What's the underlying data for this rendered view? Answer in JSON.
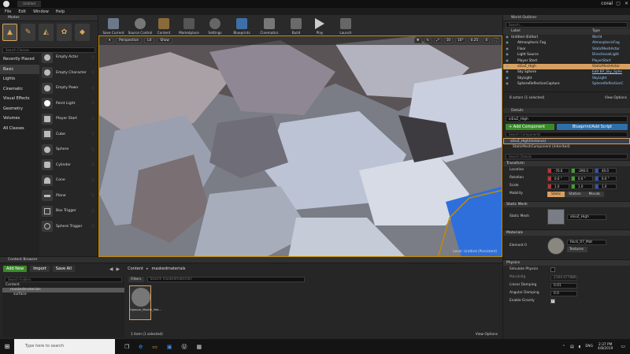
{
  "titlebar": {
    "tab": "Untitled",
    "user": "coral",
    "win_min": "—",
    "win_max": "▢",
    "win_close": "✕"
  },
  "menu": [
    "File",
    "Edit",
    "Window",
    "Help"
  ],
  "modes": {
    "title": "Modes",
    "search_placeholder": "Search Classes",
    "categories": [
      "Recently Placed",
      "Basic",
      "Lights",
      "Cinematic",
      "Visual Effects",
      "Geometry",
      "Volumes",
      "All Classes"
    ],
    "items": [
      "Empty Actor",
      "Empty Character",
      "Empty Pawn",
      "Point Light",
      "Player Start",
      "Cube",
      "Sphere",
      "Cylinder",
      "Cone",
      "Plane",
      "Box Trigger",
      "Sphere Trigger"
    ]
  },
  "toolbar": [
    "Save Current",
    "Source Control",
    "Content",
    "Marketplace",
    "Settings",
    "Blueprints",
    "Cinematics",
    "Build",
    "Play",
    "Launch"
  ],
  "viewport": {
    "mode": "Perspective",
    "lit": "Lit",
    "show": "Show",
    "fov": "10°",
    "grid": "10",
    "angle": "0.25",
    "cam": "4",
    "level_label": "Level:",
    "level_name": "Untitled (Persistent)"
  },
  "outliner": {
    "title": "World Outliner",
    "search_placeholder": "Search...",
    "col_label": "Label",
    "col_type": "Type",
    "rows": [
      {
        "name": "Untitled (Editor)",
        "type": "World"
      },
      {
        "name": "Atmospheric Fog",
        "type": "AtmosphericFog"
      },
      {
        "name": "Floor",
        "type": "StaticMeshActor"
      },
      {
        "name": "Light Source",
        "type": "DirectionalLight"
      },
      {
        "name": "Player Start",
        "type": "PlayerStart"
      },
      {
        "name": "siEoZ_High",
        "type": "StaticMeshActor"
      },
      {
        "name": "Sky Sphere",
        "type": "Edit BP_Sky_Sphe"
      },
      {
        "name": "SkyLight",
        "type": "SkyLight"
      },
      {
        "name": "SphereReflectionCapture",
        "type": "SphereReflectionC"
      }
    ],
    "footer": "8 actors (1 selected)",
    "view_options": "View Options"
  },
  "details": {
    "title": "Details",
    "actor_name": "siEoZ_High",
    "add_component": "+ Add Component",
    "blueprint_btn": "Blueprint/Add Script",
    "search_components": "Search Components",
    "component_instance": "siEoZ_High(Instance)",
    "component_mesh": "StaticMeshComponent (Inherited)",
    "search_details": "Search Details",
    "transform": "Transform",
    "location_label": "Location",
    "location": [
      "-70.0",
      "-290.0",
      "40.0"
    ],
    "rotation_label": "Rotation",
    "rotation": [
      "0.0 °",
      "0.0 °",
      "0.0 °"
    ],
    "scale_label": "Scale",
    "scale": [
      "1.0",
      "1.0",
      "1.0"
    ],
    "mobility_label": "Mobility",
    "mobility": [
      "Static",
      "Station",
      "Movab"
    ],
    "static_mesh_section": "Static Mesh",
    "static_mesh_label": "Static Mesh",
    "static_mesh_value": "siEoZ_High",
    "materials_section": "Materials",
    "element_label": "Element 0",
    "material_value": "Rock_07_Mat",
    "textures": "Textures",
    "physics_section": "Physics",
    "sim_physics": "Simulate Physics",
    "mass_label": "MassInKg",
    "mass_value": "2164.477886",
    "linear_damping": "Linear Damping",
    "linear_damping_value": "0.01",
    "angular_damping": "Angular Damping",
    "angular_damping_value": "0.0",
    "enable_gravity": "Enable Gravity"
  },
  "content_browser": {
    "title": "Content Browser",
    "add_new": "Add New",
    "import": "Import",
    "save_all": "Save All",
    "path": [
      "Content",
      "maskedmaterials"
    ],
    "search_folders": "Search Folders",
    "filters": "Filters",
    "search_assets": "Search maskedmaterials",
    "tree": [
      "Content",
      "maskedmaterials",
      "surface"
    ],
    "asset_name": "Opaque_Master_Mat...",
    "asset_full": "Opaque_Master_Material",
    "footer": "1 item (1 selected)",
    "view_options": "View Options"
  },
  "taskbar": {
    "search": "Type here to search",
    "lang": "ENG",
    "time": "2:37 PM",
    "date": "4/8/2019"
  },
  "colors": {
    "accent": "#d8a060",
    "panel": "#262626",
    "add_green": "#3a8a2a",
    "blueprint_blue": "#2f6fa8",
    "select_outline": "#c58a00"
  }
}
